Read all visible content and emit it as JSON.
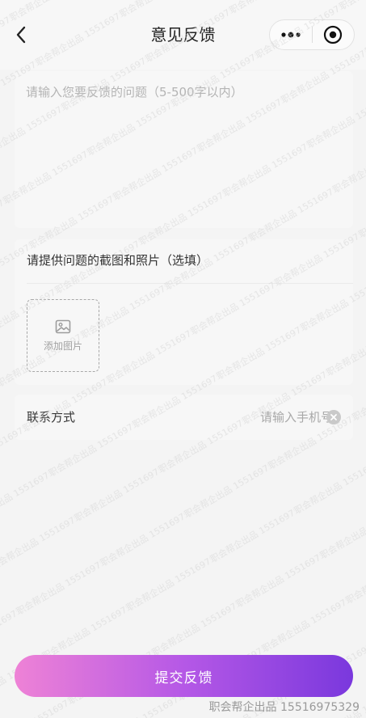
{
  "nav": {
    "title": "意见反馈",
    "back_icon": "chevron-left-icon",
    "more_icon": "more-dots-icon",
    "close_icon": "record-circle-icon"
  },
  "feedback": {
    "placeholder": "请输入您要反馈的问题（5-500字以内）",
    "value": ""
  },
  "photos": {
    "label": "请提供问题的截图和照片（选填）",
    "add_label": "添加图片",
    "add_icon": "image-icon"
  },
  "contact": {
    "label": "联系方式",
    "placeholder": "请输入手机号",
    "value": "",
    "clear_icon": "clear-circle-icon"
  },
  "submit": {
    "label": "提交反馈"
  },
  "watermark": {
    "text": "职会帮企出品 15516975329"
  },
  "colors": {
    "gradient_start": "#ee82d6",
    "gradient_end": "#7a38dd",
    "background": "#f4f4f4"
  }
}
